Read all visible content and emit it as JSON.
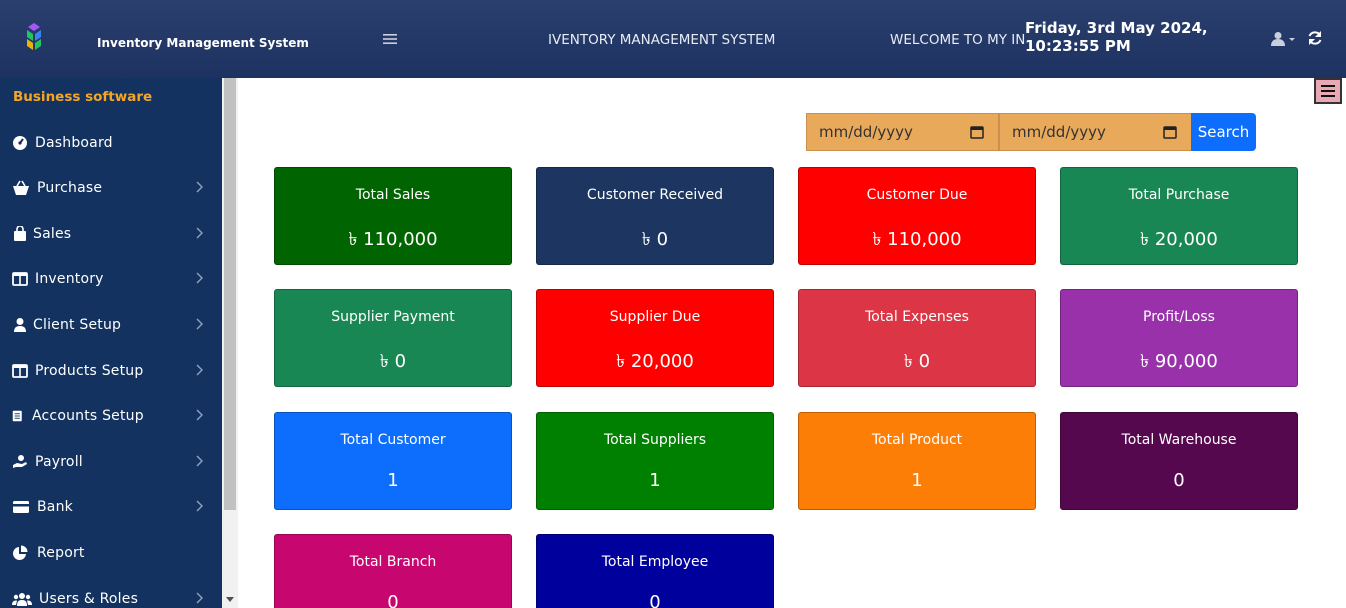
{
  "header": {
    "app_name": "Inventory Management System",
    "menu_icon": "hamburger-icon",
    "marquee_part1": "IVENTORY MANAGEMENT SYSTEM",
    "marquee_part2": "WELCOME TO MY IN",
    "date_line": "Friday, 3rd May 2024,",
    "time_line": "10:23:55 PM",
    "user_icon": "user-icon",
    "refresh_icon": "refresh-icon"
  },
  "sidebar": {
    "brand": "Business software",
    "items": [
      {
        "label": "Dashboard",
        "icon": "gauge-icon",
        "has_submenu": false
      },
      {
        "label": "Purchase",
        "icon": "basket-icon",
        "has_submenu": true
      },
      {
        "label": "Sales",
        "icon": "shopping-bag-icon",
        "has_submenu": true
      },
      {
        "label": "Inventory",
        "icon": "columns-icon",
        "has_submenu": true
      },
      {
        "label": "Client Setup",
        "icon": "user-icon",
        "has_submenu": true
      },
      {
        "label": "Products Setup",
        "icon": "columns-icon",
        "has_submenu": true
      },
      {
        "label": "Accounts Setup",
        "icon": "document-icon",
        "has_submenu": true
      },
      {
        "label": "Payroll",
        "icon": "hand-money-icon",
        "has_submenu": true
      },
      {
        "label": "Bank",
        "icon": "credit-card-icon",
        "has_submenu": true
      },
      {
        "label": "Report",
        "icon": "pie-chart-icon",
        "has_submenu": false
      },
      {
        "label": "Users & Roles",
        "icon": "users-icon",
        "has_submenu": true
      }
    ]
  },
  "filter": {
    "from_placeholder": "mm/dd/yyyy",
    "to_placeholder": "mm/dd/yyyy",
    "search_label": "Search"
  },
  "colors": {
    "topbar": "#1d3260",
    "sidebar": "#13325f",
    "brand_accent": "#f5a623",
    "date_input": "#e8a95b",
    "search_button": "#0d6efd"
  },
  "cards": [
    {
      "title": "Total Sales",
      "value": "৳ 110,000",
      "color": "#006400"
    },
    {
      "title": "Customer Received",
      "value": "৳ 0",
      "color": "#1c3661"
    },
    {
      "title": "Customer Due",
      "value": "৳ 110,000",
      "color": "#ff0000"
    },
    {
      "title": "Total Purchase",
      "value": "৳ 20,000",
      "color": "#198754"
    },
    {
      "title": "Supplier Payment",
      "value": "৳ 0",
      "color": "#198754"
    },
    {
      "title": "Supplier Due",
      "value": "৳ 20,000",
      "color": "#ff0000"
    },
    {
      "title": "Total Expenses",
      "value": "৳ 0",
      "color": "#dc3545"
    },
    {
      "title": "Profit/Loss",
      "value": "৳ 90,000",
      "color": "#9932aa"
    },
    {
      "title": "Total Customer",
      "value": "1",
      "color": "#0d6efd"
    },
    {
      "title": "Total Suppliers",
      "value": "1",
      "color": "#008000"
    },
    {
      "title": "Total Product",
      "value": "1",
      "color": "#fd7e07"
    },
    {
      "title": "Total Warehouse",
      "value": "0",
      "color": "#55084d"
    },
    {
      "title": "Total Branch",
      "value": "0",
      "color": "#c8066f"
    },
    {
      "title": "Total Employee",
      "value": "0",
      "color": "#00009c"
    }
  ]
}
